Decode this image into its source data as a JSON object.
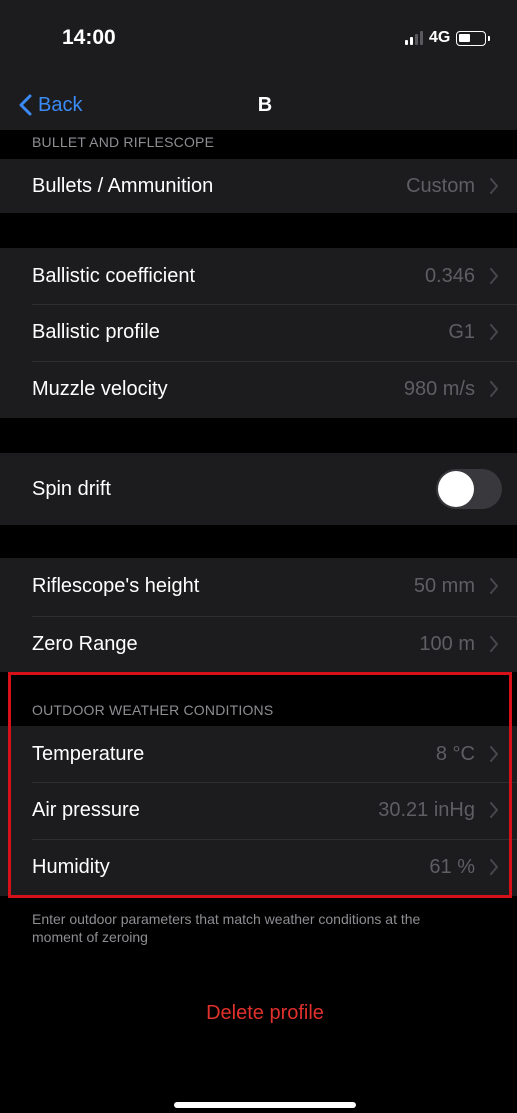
{
  "status_bar": {
    "time": "14:00",
    "network": "4G",
    "battery_level": 0.4
  },
  "nav": {
    "back_label": "Back",
    "title": "B"
  },
  "sections": {
    "bullet_riflescope_header": "BULLET AND RIFLESCOPE",
    "weather_header": "OUTDOOR WEATHER CONDITIONS"
  },
  "rows": {
    "bullets": {
      "label": "Bullets / Ammunition",
      "value": "Custom"
    },
    "ballistic_coefficient": {
      "label": "Ballistic coefficient",
      "value": "0.346"
    },
    "ballistic_profile": {
      "label": "Ballistic profile",
      "value": "G1"
    },
    "muzzle_velocity": {
      "label": "Muzzle velocity",
      "value": "980 m/s"
    },
    "spin_drift": {
      "label": "Spin drift",
      "enabled": false
    },
    "riflescope_height": {
      "label": "Riflescope's height",
      "value": "50 mm"
    },
    "zero_range": {
      "label": "Zero Range",
      "value": "100 m"
    },
    "temperature": {
      "label": "Temperature",
      "value": "8 °C"
    },
    "air_pressure": {
      "label": "Air pressure",
      "value": "30.21 inHg"
    },
    "humidity": {
      "label": "Humidity",
      "value": "61 %"
    }
  },
  "footer_note": "Enter outdoor parameters that match weather conditions at the moment of zeroing",
  "delete_label": "Delete profile",
  "colors": {
    "background": "#000000",
    "cell_background": "#1c1c1e",
    "accent_blue": "#3a8bf5",
    "destructive_red": "#e0302c",
    "highlight_border": "#d8101a",
    "secondary_text": "#8e8e93"
  }
}
